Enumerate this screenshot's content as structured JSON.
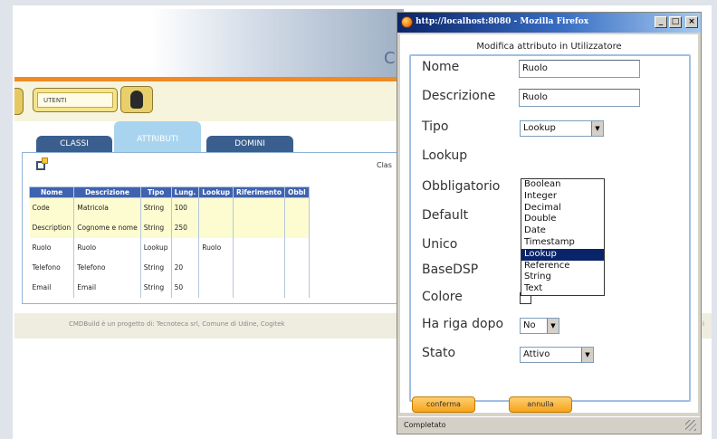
{
  "background_app": {
    "banner_letter": "C",
    "user_field": "UTENTI",
    "tabs": [
      {
        "label": "CLASSI"
      },
      {
        "label": "ATTRIBUTI"
      },
      {
        "label": "DOMINI"
      }
    ],
    "side_label": "Clas",
    "table": {
      "headers": [
        "Nome",
        "Descrizione",
        "Tipo",
        "Lung.",
        "Lookup",
        "Riferimento",
        "Obbl"
      ],
      "rows": [
        {
          "nome": "Code",
          "descrizione": "Matricola",
          "tipo": "String",
          "lung": "100",
          "lookup": "",
          "riferimento": "",
          "obbl": ""
        },
        {
          "nome": "Description",
          "descrizione": "Cognome e nome",
          "tipo": "String",
          "lung": "250",
          "lookup": "",
          "riferimento": "",
          "obbl": ""
        },
        {
          "nome": "Ruolo",
          "descrizione": "Ruolo",
          "tipo": "Lookup",
          "lung": "",
          "lookup": "Ruolo",
          "riferimento": "",
          "obbl": ""
        },
        {
          "nome": "Telefono",
          "descrizione": "Telefono",
          "tipo": "String",
          "lung": "20",
          "lookup": "",
          "riferimento": "",
          "obbl": ""
        },
        {
          "nome": "Email",
          "descrizione": "Email",
          "tipo": "String",
          "lung": "50",
          "lookup": "",
          "riferimento": "",
          "obbl": ""
        }
      ]
    },
    "footer": "CMDBuild è un progetto di: Tecnoteca srl, Comune di Udine, Cogitek",
    "footer_edge": "i"
  },
  "popup": {
    "title": "http://localhost:8080 - Mozilla Firefox",
    "buttons": {
      "minimize": "_",
      "maximize": "□",
      "close": "×"
    },
    "heading": "Modifica attributo in Utilizzatore",
    "fields": {
      "nome": {
        "label": "Nome",
        "value": "Ruolo"
      },
      "descrizione": {
        "label": "Descrizione",
        "value": "Ruolo"
      },
      "tipo": {
        "label": "Tipo",
        "value": "Lookup"
      },
      "lookup": {
        "label": "Lookup"
      },
      "obbligatorio": {
        "label": "Obbligatorio"
      },
      "default": {
        "label": "Default"
      },
      "unico": {
        "label": "Unico"
      },
      "basedsp": {
        "label": "BaseDSP"
      },
      "colore": {
        "label": "Colore"
      },
      "ha_riga_dopo": {
        "label": "Ha riga dopo",
        "value": "No"
      },
      "stato": {
        "label": "Stato",
        "value": "Attivo"
      }
    },
    "tipo_options": [
      "Boolean",
      "Integer",
      "Decimal",
      "Double",
      "Date",
      "Timestamp",
      "Lookup",
      "Reference",
      "String",
      "Text"
    ],
    "tipo_selected": "Lookup",
    "confirm_label": "conferma",
    "cancel_label": "annulla",
    "status": "Completato"
  },
  "colors": {
    "accent_orange": "#f08a24",
    "tab_blue": "#3a5f8e",
    "header_blue": "#3f63b0",
    "selection": "#0a246a"
  }
}
